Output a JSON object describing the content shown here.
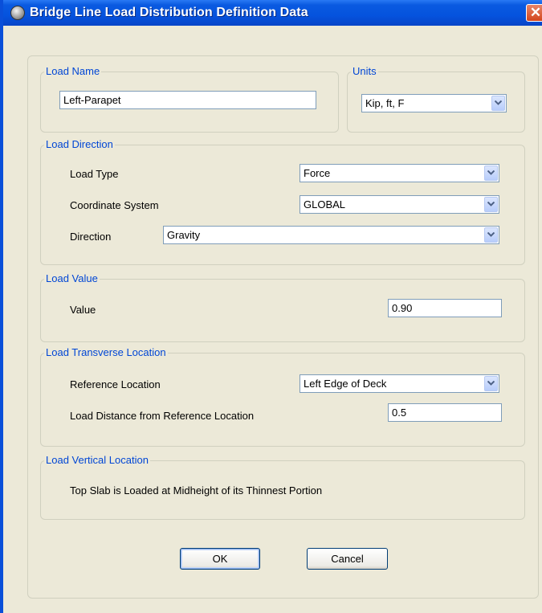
{
  "window": {
    "title": "Bridge Line Load Distribution Definition Data",
    "close_glyph": "✕"
  },
  "load_name": {
    "legend": "Load Name",
    "value": "Left-Parapet"
  },
  "units": {
    "legend": "Units",
    "selected": "Kip, ft, F"
  },
  "load_direction": {
    "legend": "Load Direction",
    "load_type": {
      "label": "Load Type",
      "selected": "Force"
    },
    "coordinate_system": {
      "label": "Coordinate System",
      "selected": "GLOBAL"
    },
    "direction": {
      "label": "Direction",
      "selected": "Gravity"
    }
  },
  "load_value": {
    "legend": "Load Value",
    "label": "Value",
    "value": "0.90"
  },
  "transverse_location": {
    "legend": "Load Transverse Location",
    "reference_location": {
      "label": "Reference Location",
      "selected": "Left Edge of Deck"
    },
    "distance": {
      "label": "Load Distance from Reference Location",
      "value": "0.5"
    }
  },
  "vertical_location": {
    "legend": "Load Vertical Location",
    "text": "Top Slab is Loaded at Midheight of its Thinnest Portion"
  },
  "buttons": {
    "ok": "OK",
    "cancel": "Cancel"
  },
  "icons": {
    "app": "app-globe-icon",
    "dropdown": "chevron-down-icon"
  },
  "colors": {
    "titlebar": "#0553de",
    "legend_text": "#0046d5",
    "dialog_bg": "#ece9d8",
    "close": "#d2451c"
  }
}
